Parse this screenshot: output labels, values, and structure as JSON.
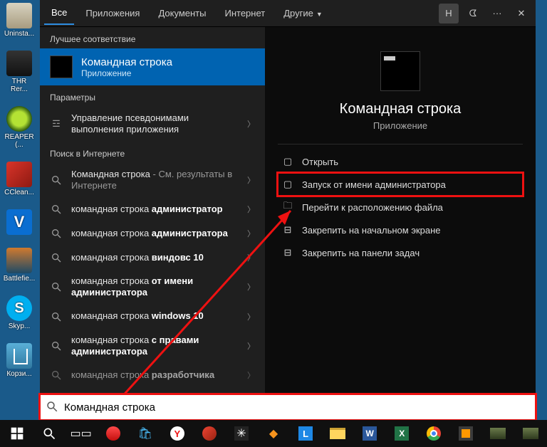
{
  "desktop_icons": {
    "uninstall": "Uninsta...",
    "thr": "THR Rer...",
    "reaper": "REAPER (...",
    "ccleaner": "CClean...",
    "battlefield": "Battlefie...",
    "skype": "Skyp...",
    "bin": "Корзи..."
  },
  "tabs": {
    "all": "Все",
    "apps": "Приложения",
    "docs": "Документы",
    "web": "Интернет",
    "more": "Другие"
  },
  "header": {
    "avatar_letter": "Н"
  },
  "sections": {
    "best": "Лучшее соответствие",
    "settings": "Параметры",
    "web": "Поиск в Интернете"
  },
  "best_match": {
    "title": "Командная строка",
    "sub": "Приложение"
  },
  "settings_row": "Управление псевдонимами выполнения приложения",
  "web_rows": {
    "r1_prefix": "Командная строка",
    "r1_suffix": " - См. результаты в Интернете",
    "r2_pre": "командная строка ",
    "r2_b": "администратор",
    "r3_pre": "командная строка ",
    "r3_b": "администратора",
    "r4_pre": "командная строка ",
    "r4_b": "виндовс 10",
    "r5_pre": "командная строка ",
    "r5_b": "от имени администратора",
    "r6_pre": "командная строка ",
    "r6_b": "windows 10",
    "r7_pre": "командная строка ",
    "r7_b": "с правами администратора",
    "r8_pre": "командная строка ",
    "r8_b": "разработчика"
  },
  "detail": {
    "title": "Командная строка",
    "sub": "Приложение",
    "actions": {
      "open": "Открыть",
      "admin": "Запуск от имени администратора",
      "location": "Перейти к расположению файла",
      "pin_start": "Закрепить на начальном экране",
      "pin_taskbar": "Закрепить на панели задач"
    }
  },
  "search": {
    "value": "Командная строка"
  }
}
